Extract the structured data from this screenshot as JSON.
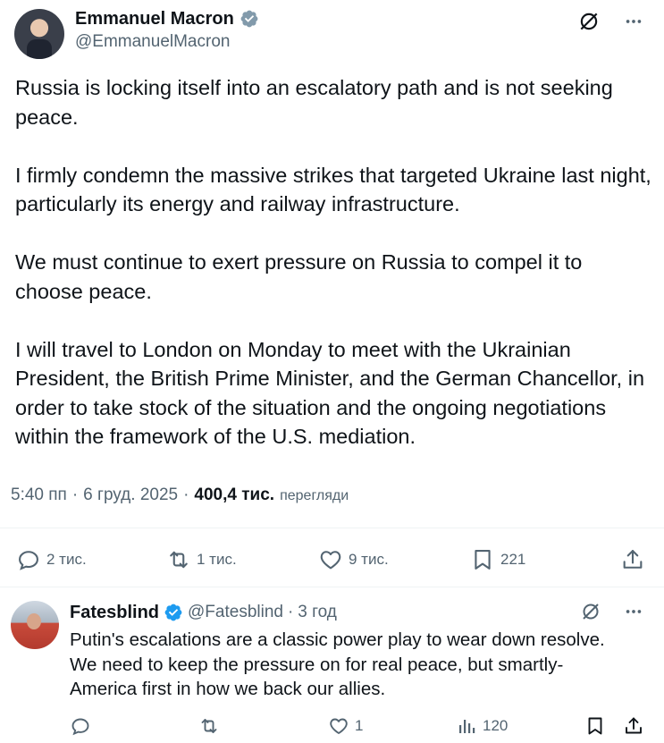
{
  "tweet": {
    "author_name": "Emmanuel Macron",
    "author_handle": "@EmmanuelMacron",
    "text": "Russia is locking itself into an escalatory path and is not seeking peace.\n\nI firmly condemn the massive strikes that targeted Ukraine last night, particularly its energy and railway infrastructure.\n\nWe must continue to exert pressure on Russia to compel it to choose peace.\n\nI will travel to London on Monday to meet with the Ukrainian President, the British Prime Minister, and the German Chancellor, in order to take stock of the situation and the ongoing negotiations within the framework of the U.S. mediation.",
    "time": "5:40 пп",
    "sep1": "·",
    "date": "6 груд. 2025",
    "sep2": "·",
    "views_count": "400,4 тис.",
    "views_label": "перегляди",
    "replies": "2 тис.",
    "reposts": "1 тис.",
    "likes": "9 тис.",
    "bookmarks": "221"
  },
  "reply": {
    "author_name": "Fatesblind",
    "author_handle": "@Fatesblind",
    "sep": "·",
    "time": "3 год",
    "text": "Putin's escalations are a classic power play to wear down resolve.\nWe need to keep the pressure on for real peace, but smartly-\nAmerica first in how we back our allies.",
    "likes": "1",
    "views": "120"
  },
  "colors": {
    "verified_blue": "#1d9bf0",
    "text_primary": "#0f1419",
    "text_secondary": "#536471"
  },
  "icons": {
    "verified": "verified-badge-icon",
    "grok": "grok-icon",
    "more": "more-icon",
    "reply": "reply-icon",
    "repost": "repost-icon",
    "like": "heart-icon",
    "bookmark": "bookmark-icon",
    "share": "share-icon",
    "views": "views-icon"
  }
}
